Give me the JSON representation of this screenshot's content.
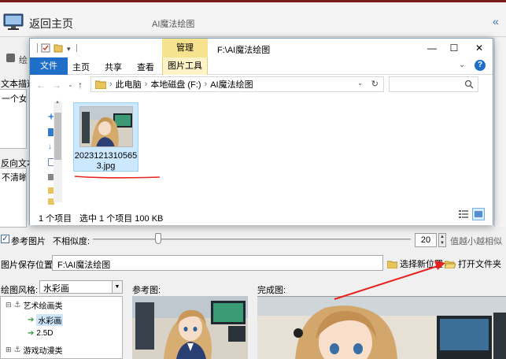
{
  "app": {
    "back_home": "返回主页",
    "title": "AI魔法绘图",
    "collapse": "«",
    "side_text": "绘",
    "text_desc_label": "文本描述",
    "text_desc_value": "一个女孩",
    "neg_label": "反向文本",
    "neg_value": "不清晰,",
    "ref_checkbox_label": "参考图片",
    "ref_checked": "✓",
    "dissim_label": "不相似度:",
    "dissim_value": "20",
    "dissim_level": 0.2,
    "strength_label": "值越小越相似",
    "save_label": "图片保存位置:",
    "save_path": "F:\\AI魔法绘图",
    "new_pos_label": "选择新位置",
    "open_folder_label": "打开文件夹",
    "style_label": "绘图风格:",
    "style_value": "水彩画",
    "tree": {
      "art": "艺术绘画类",
      "watercolor": "水彩画",
      "d25": "2.5D",
      "anime": "游戏动漫类"
    },
    "ref_img_label": "参考图:",
    "done_img_label": "完成图:"
  },
  "explorer": {
    "manage_tab": "管理",
    "window_title": "F:\\AI魔法绘图",
    "minimize": "—",
    "maximize": "☐",
    "close": "✕",
    "tabs": {
      "file": "文件",
      "home": "主页",
      "share": "共享",
      "view": "查看",
      "picture_tools": "图片工具"
    },
    "help": "?",
    "breadcrumb": {
      "pc": "此电脑",
      "disk": "本地磁盘 (F:)",
      "folder": "AI魔法绘图",
      "sep": "›"
    },
    "file": {
      "name_line1": "2023121310565",
      "name_line2": "3.jpg"
    },
    "status": {
      "count": "1 个项目",
      "selected": "选中 1 个项目  100 KB"
    }
  },
  "colors": {
    "accent_blue": "#1f6fc8",
    "manage_yellow": "#f7e28d",
    "annotation_red": "#e8231f"
  }
}
